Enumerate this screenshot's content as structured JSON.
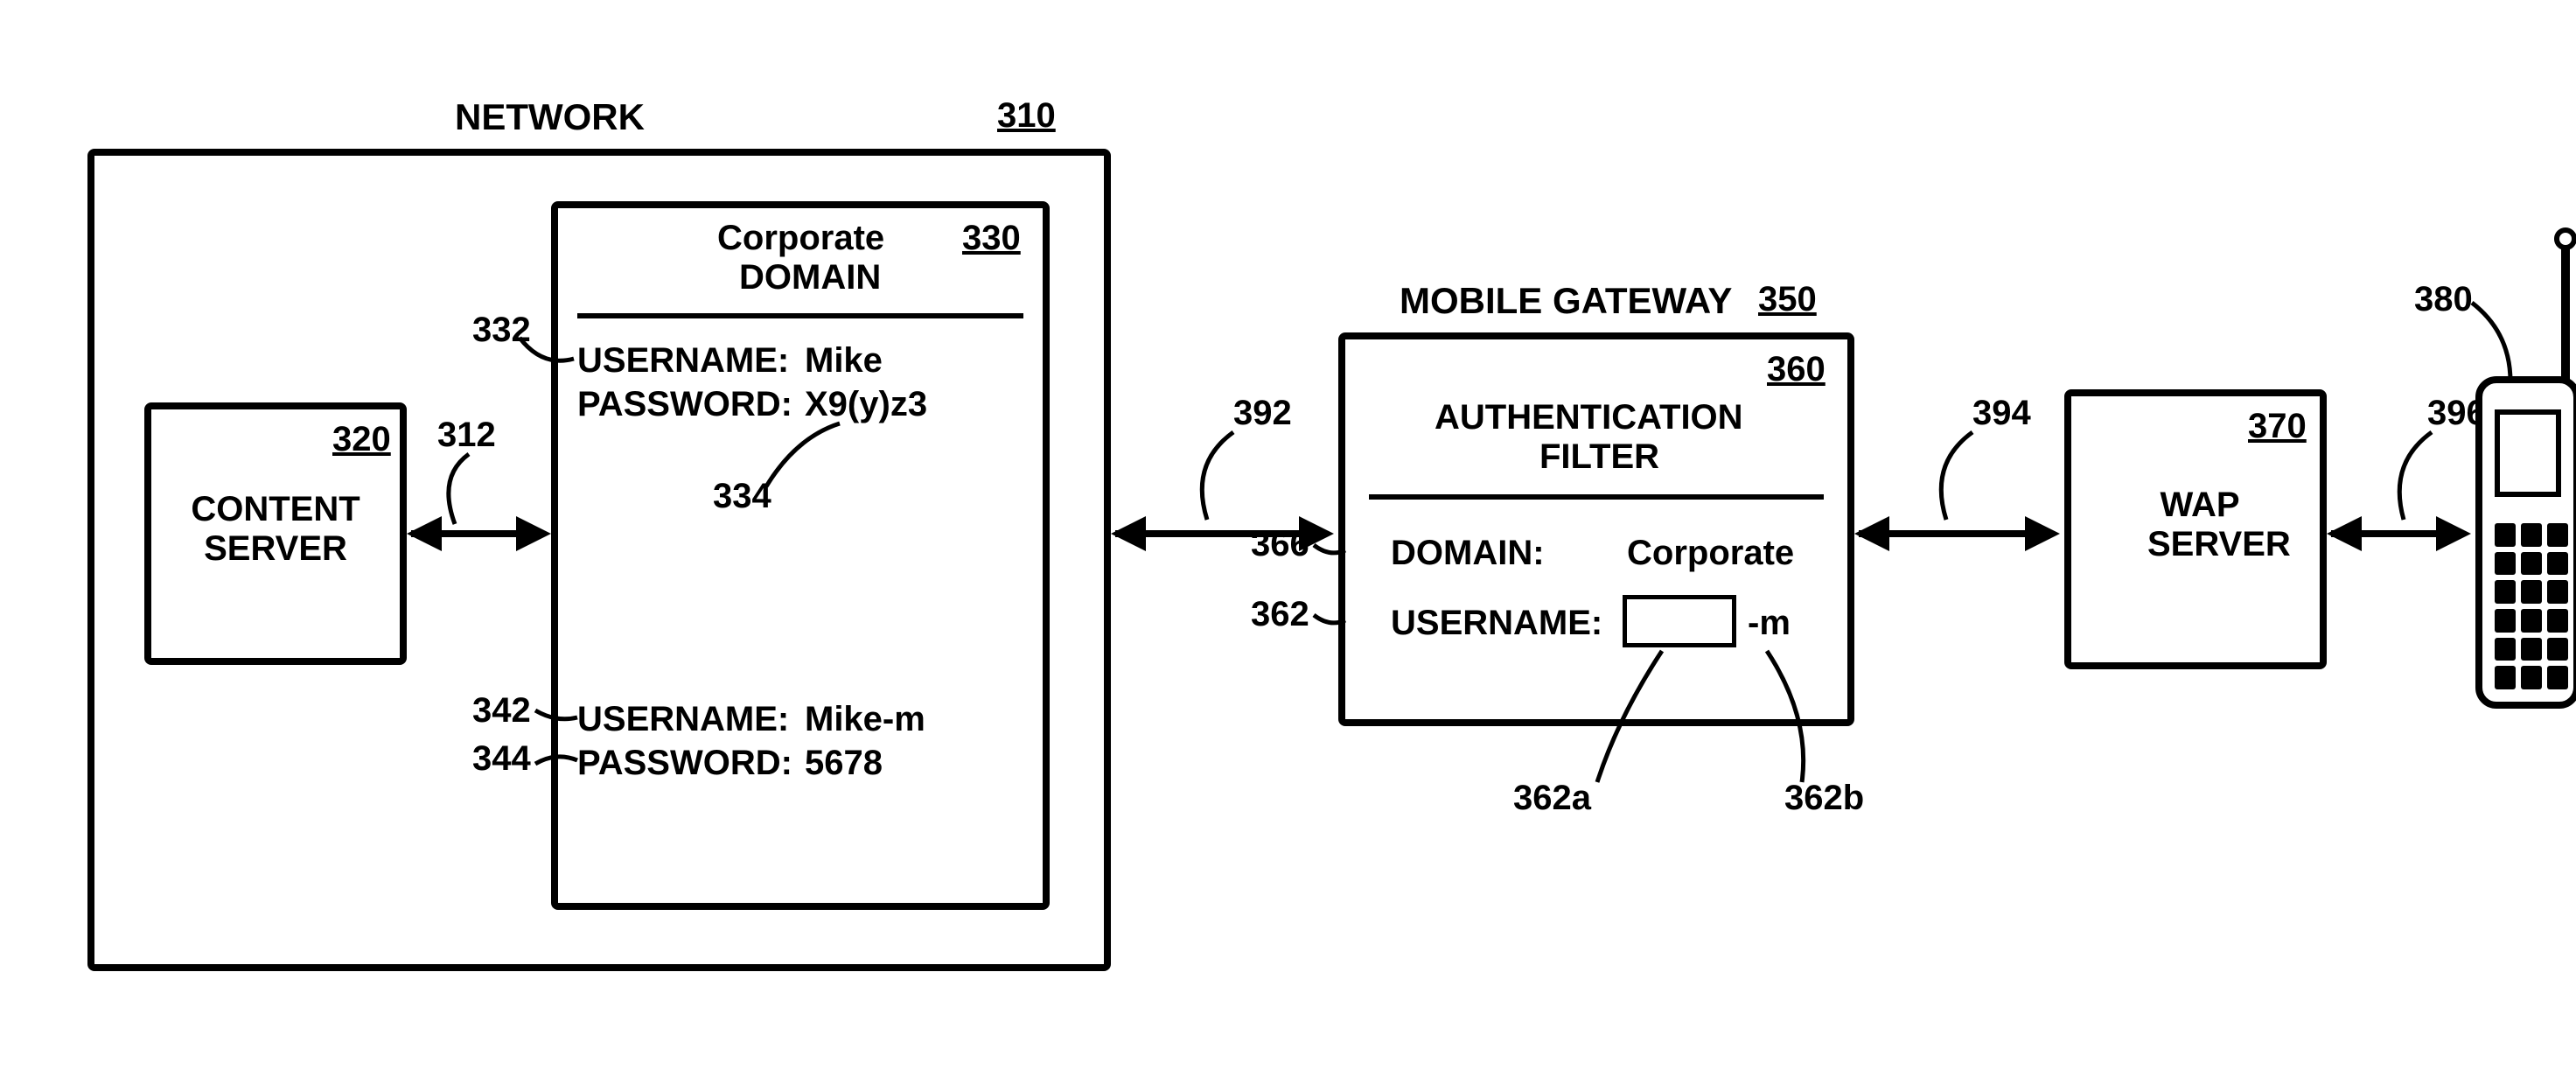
{
  "network": {
    "title": "NETWORK",
    "ref": "310",
    "content_server": {
      "title": "CONTENT SERVER",
      "ref": "320"
    },
    "arrow_cs_cd_ref": "312",
    "corporate_domain": {
      "title_line1": "Corporate",
      "title_line2": "DOMAIN",
      "ref": "330",
      "user1": {
        "label": "USERNAME:",
        "value": "Mike",
        "ref": "332"
      },
      "pass1": {
        "label": "PASSWORD:",
        "value": "X9(y)z3",
        "ref": "334"
      },
      "user2": {
        "label": "USERNAME:",
        "value": "Mike-m",
        "ref": "342"
      },
      "pass2": {
        "label": "PASSWORD:",
        "value": "5678",
        "ref": "344"
      }
    }
  },
  "mobile_gateway": {
    "title": "MOBILE GATEWAY",
    "ref": "350",
    "filter": {
      "title_line1": "AUTHENTICATION",
      "title_line2": "FILTER",
      "ref": "360",
      "domain": {
        "label": "DOMAIN:",
        "value": "Corporate",
        "ref": "366"
      },
      "username": {
        "label": "USERNAME:",
        "suffix": "-m",
        "ref": "362",
        "field_ref": "362a",
        "suffix_ref": "362b"
      }
    }
  },
  "wap_server": {
    "title": "WAP SERVER",
    "ref": "370"
  },
  "phone_ref": "380",
  "arrows": {
    "net_mg_ref": "392",
    "mg_wap_ref": "394",
    "wap_phone_ref": "396"
  }
}
